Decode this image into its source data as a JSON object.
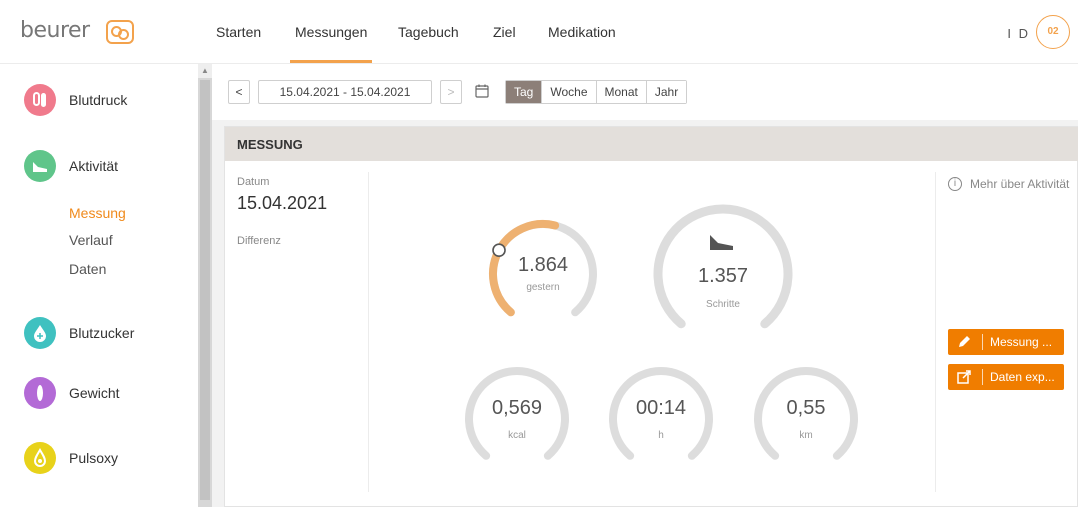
{
  "brand": {
    "name": "beurer"
  },
  "nav": [
    {
      "label": "Starten"
    },
    {
      "label": "Messungen"
    },
    {
      "label": "Tagebuch"
    },
    {
      "label": "Ziel"
    },
    {
      "label": "Medikation"
    }
  ],
  "nav_active": "Messungen",
  "user": {
    "initials": "I D",
    "avatar": "02"
  },
  "sidebar": {
    "items": [
      {
        "label": "Blutdruck",
        "icon": "blood-pressure-icon",
        "color": "#f07a8c"
      },
      {
        "label": "Aktivität",
        "icon": "shoe-icon",
        "color": "#5fc58a"
      },
      {
        "label": "Blutzucker",
        "icon": "drop-icon",
        "color": "#3fc1c0"
      },
      {
        "label": "Gewicht",
        "icon": "scale-icon",
        "color": "#b36ad6"
      },
      {
        "label": "Pulsoxy",
        "icon": "pulse-icon",
        "color": "#e8d21a"
      }
    ],
    "sub_items": [
      {
        "label": "Messung",
        "active": true
      },
      {
        "label": "Verlauf",
        "active": false
      },
      {
        "label": "Daten",
        "active": false
      }
    ]
  },
  "toolbar": {
    "prev": "<",
    "next": ">",
    "date_range": "15.04.2021 - 15.04.2021",
    "periods": [
      "Tag",
      "Woche",
      "Monat",
      "Jahr"
    ],
    "active_period": "Tag"
  },
  "card": {
    "title": "MESSUNG",
    "date_label": "Datum",
    "date_value": "15.04.2021",
    "diff_label": "Differenz"
  },
  "gauges": [
    {
      "value": "1.864",
      "label": "gestern",
      "fill": 0.55,
      "color": "#f3a24c"
    },
    {
      "value": "1.357",
      "label": "Schritte",
      "fill": 0.0,
      "color": "#f3a24c"
    },
    {
      "value": "0,569",
      "label": "kcal",
      "fill": 0.0,
      "color": "#f3a24c"
    },
    {
      "value": "00:14",
      "label": "h",
      "fill": 0.0,
      "color": "#f3a24c"
    },
    {
      "value": "0,55",
      "label": "km",
      "fill": 0.0,
      "color": "#f3a24c"
    }
  ],
  "info": {
    "icon": "info-icon",
    "text": "Mehr über Aktivität"
  },
  "actions": {
    "measure": {
      "label": "Messung ...",
      "icon": "pencil-icon"
    },
    "export": {
      "label": "Daten exp...",
      "icon": "export-icon"
    }
  },
  "colors": {
    "accent": "#f3a24c",
    "button": "#f07d00",
    "active_period": "#8c7f78",
    "gauge_track": "#dddddd"
  }
}
